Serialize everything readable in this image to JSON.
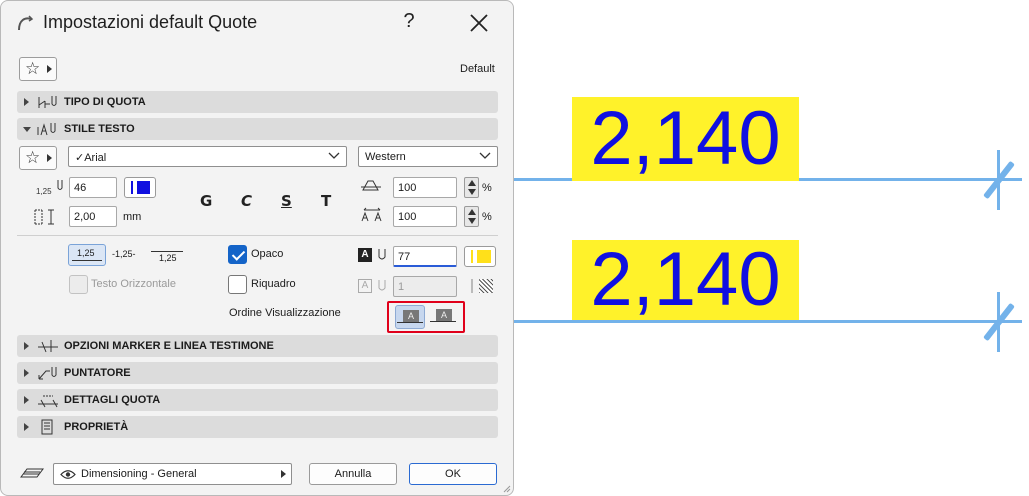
{
  "dialog": {
    "title": "Impostazioni default Quote",
    "help_label": "?",
    "default_label": "Default"
  },
  "sections": {
    "tipo_quota": "TIPO DI QUOTA",
    "stile_testo": "STILE TESTO",
    "opzioni_marker": "OPZIONI MARKER E LINEA TESTIMONE",
    "puntatore": "PUNTATORE",
    "dettagli_quota": "DETTAGLI QUOTA",
    "proprieta": "PROPRIETÀ"
  },
  "text_style": {
    "font": "Arial",
    "font_check": "✓",
    "script": "Western",
    "size_icon_label": "1,25",
    "size_value": "46",
    "spacing_value": "2,00",
    "spacing_unit": "mm",
    "bold": "G",
    "italic": "C",
    "underline": "S",
    "strike": "T",
    "width_value": "100",
    "width_unit": "%",
    "spacing_pct_value": "100",
    "spacing_pct_unit": "%",
    "text_color": "#1010e0"
  },
  "position": {
    "opt1": "1,25",
    "opt2": "-1,25-",
    "opt3": "1,25",
    "testo_orizzontale": "Testo Orizzontale",
    "opaco": "Opaco",
    "opaco_checked": true,
    "riquadro": "Riquadro",
    "riquadro_checked": false,
    "fill_pen": "77",
    "frame_pen": "1",
    "fill_color": "#ffe01a",
    "ordine_label": "Ordine Visualizzazione",
    "highlight_color": "#e0001a"
  },
  "footer": {
    "view_label": "Dimensioning - General",
    "cancel": "Annulla",
    "ok": "OK"
  },
  "preview": {
    "dim1": "2,140",
    "dim2": "2,140",
    "line_color": "#73b2ea",
    "text_bg": "#fff22a"
  }
}
